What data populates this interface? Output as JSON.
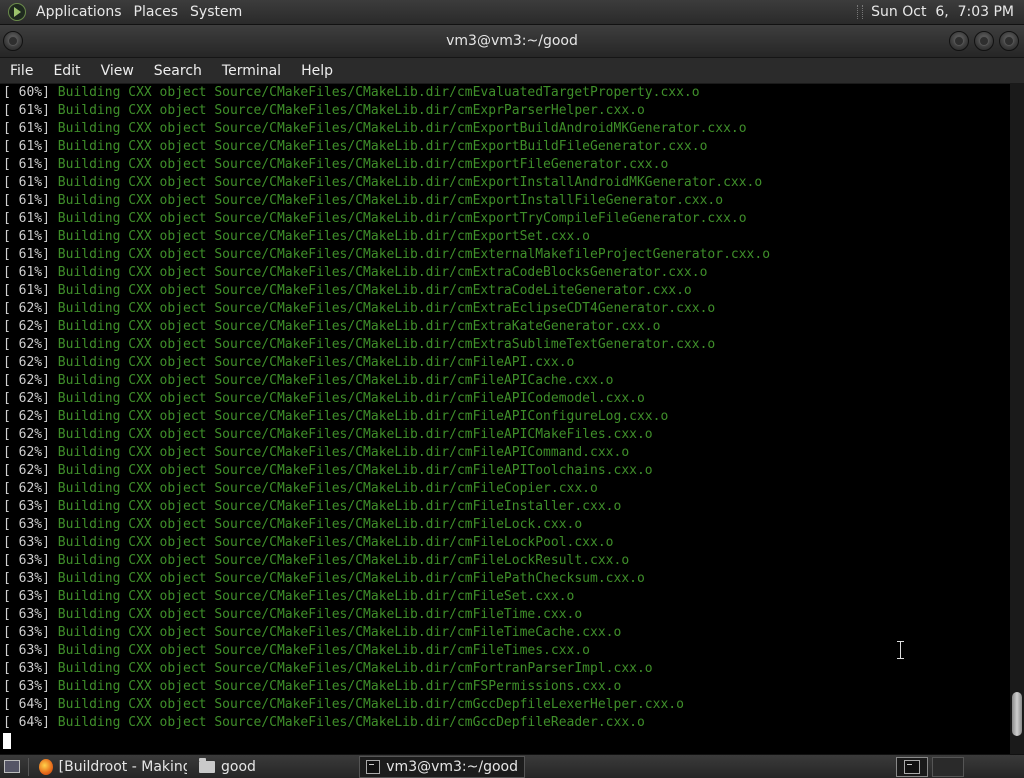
{
  "top_panel": {
    "menus": [
      "Applications",
      "Places",
      "System"
    ],
    "clock": "Sun Oct  6,  7:03 PM"
  },
  "window": {
    "title": "vm3@vm3:~/good"
  },
  "menubar": [
    "File",
    "Edit",
    "View",
    "Search",
    "Terminal",
    "Help"
  ],
  "terminal": {
    "lines": [
      {
        "pct": "[ 60%]",
        "msg": "Building CXX object Source/CMakeFiles/CMakeLib.dir/cmEvaluatedTargetProperty.cxx.o"
      },
      {
        "pct": "[ 61%]",
        "msg": "Building CXX object Source/CMakeFiles/CMakeLib.dir/cmExprParserHelper.cxx.o"
      },
      {
        "pct": "[ 61%]",
        "msg": "Building CXX object Source/CMakeFiles/CMakeLib.dir/cmExportBuildAndroidMKGenerator.cxx.o"
      },
      {
        "pct": "[ 61%]",
        "msg": "Building CXX object Source/CMakeFiles/CMakeLib.dir/cmExportBuildFileGenerator.cxx.o"
      },
      {
        "pct": "[ 61%]",
        "msg": "Building CXX object Source/CMakeFiles/CMakeLib.dir/cmExportFileGenerator.cxx.o"
      },
      {
        "pct": "[ 61%]",
        "msg": "Building CXX object Source/CMakeFiles/CMakeLib.dir/cmExportInstallAndroidMKGenerator.cxx.o"
      },
      {
        "pct": "[ 61%]",
        "msg": "Building CXX object Source/CMakeFiles/CMakeLib.dir/cmExportInstallFileGenerator.cxx.o"
      },
      {
        "pct": "[ 61%]",
        "msg": "Building CXX object Source/CMakeFiles/CMakeLib.dir/cmExportTryCompileFileGenerator.cxx.o"
      },
      {
        "pct": "[ 61%]",
        "msg": "Building CXX object Source/CMakeFiles/CMakeLib.dir/cmExportSet.cxx.o"
      },
      {
        "pct": "[ 61%]",
        "msg": "Building CXX object Source/CMakeFiles/CMakeLib.dir/cmExternalMakefileProjectGenerator.cxx.o"
      },
      {
        "pct": "[ 61%]",
        "msg": "Building CXX object Source/CMakeFiles/CMakeLib.dir/cmExtraCodeBlocksGenerator.cxx.o"
      },
      {
        "pct": "[ 61%]",
        "msg": "Building CXX object Source/CMakeFiles/CMakeLib.dir/cmExtraCodeLiteGenerator.cxx.o"
      },
      {
        "pct": "[ 62%]",
        "msg": "Building CXX object Source/CMakeFiles/CMakeLib.dir/cmExtraEclipseCDT4Generator.cxx.o"
      },
      {
        "pct": "[ 62%]",
        "msg": "Building CXX object Source/CMakeFiles/CMakeLib.dir/cmExtraKateGenerator.cxx.o"
      },
      {
        "pct": "[ 62%]",
        "msg": "Building CXX object Source/CMakeFiles/CMakeLib.dir/cmExtraSublimeTextGenerator.cxx.o"
      },
      {
        "pct": "[ 62%]",
        "msg": "Building CXX object Source/CMakeFiles/CMakeLib.dir/cmFileAPI.cxx.o"
      },
      {
        "pct": "[ 62%]",
        "msg": "Building CXX object Source/CMakeFiles/CMakeLib.dir/cmFileAPICache.cxx.o"
      },
      {
        "pct": "[ 62%]",
        "msg": "Building CXX object Source/CMakeFiles/CMakeLib.dir/cmFileAPICodemodel.cxx.o"
      },
      {
        "pct": "[ 62%]",
        "msg": "Building CXX object Source/CMakeFiles/CMakeLib.dir/cmFileAPIConfigureLog.cxx.o"
      },
      {
        "pct": "[ 62%]",
        "msg": "Building CXX object Source/CMakeFiles/CMakeLib.dir/cmFileAPICMakeFiles.cxx.o"
      },
      {
        "pct": "[ 62%]",
        "msg": "Building CXX object Source/CMakeFiles/CMakeLib.dir/cmFileAPICommand.cxx.o"
      },
      {
        "pct": "[ 62%]",
        "msg": "Building CXX object Source/CMakeFiles/CMakeLib.dir/cmFileAPIToolchains.cxx.o"
      },
      {
        "pct": "[ 62%]",
        "msg": "Building CXX object Source/CMakeFiles/CMakeLib.dir/cmFileCopier.cxx.o"
      },
      {
        "pct": "[ 63%]",
        "msg": "Building CXX object Source/CMakeFiles/CMakeLib.dir/cmFileInstaller.cxx.o"
      },
      {
        "pct": "[ 63%]",
        "msg": "Building CXX object Source/CMakeFiles/CMakeLib.dir/cmFileLock.cxx.o"
      },
      {
        "pct": "[ 63%]",
        "msg": "Building CXX object Source/CMakeFiles/CMakeLib.dir/cmFileLockPool.cxx.o"
      },
      {
        "pct": "[ 63%]",
        "msg": "Building CXX object Source/CMakeFiles/CMakeLib.dir/cmFileLockResult.cxx.o"
      },
      {
        "pct": "[ 63%]",
        "msg": "Building CXX object Source/CMakeFiles/CMakeLib.dir/cmFilePathChecksum.cxx.o"
      },
      {
        "pct": "[ 63%]",
        "msg": "Building CXX object Source/CMakeFiles/CMakeLib.dir/cmFileSet.cxx.o"
      },
      {
        "pct": "[ 63%]",
        "msg": "Building CXX object Source/CMakeFiles/CMakeLib.dir/cmFileTime.cxx.o"
      },
      {
        "pct": "[ 63%]",
        "msg": "Building CXX object Source/CMakeFiles/CMakeLib.dir/cmFileTimeCache.cxx.o"
      },
      {
        "pct": "[ 63%]",
        "msg": "Building CXX object Source/CMakeFiles/CMakeLib.dir/cmFileTimes.cxx.o"
      },
      {
        "pct": "[ 63%]",
        "msg": "Building CXX object Source/CMakeFiles/CMakeLib.dir/cmFortranParserImpl.cxx.o"
      },
      {
        "pct": "[ 63%]",
        "msg": "Building CXX object Source/CMakeFiles/CMakeLib.dir/cmFSPermissions.cxx.o"
      },
      {
        "pct": "[ 64%]",
        "msg": "Building CXX object Source/CMakeFiles/CMakeLib.dir/cmGccDepfileLexerHelper.cxx.o"
      },
      {
        "pct": "[ 64%]",
        "msg": "Building CXX object Source/CMakeFiles/CMakeLib.dir/cmGccDepfileReader.cxx.o"
      }
    ]
  },
  "taskbar": {
    "items": [
      {
        "label": "[Buildroot - Making ...",
        "icon": "firefox-icon"
      },
      {
        "label": "good",
        "icon": "folder-icon"
      },
      {
        "label": "vm3@vm3:~/good",
        "icon": "terminal-icon",
        "active": true
      }
    ]
  }
}
